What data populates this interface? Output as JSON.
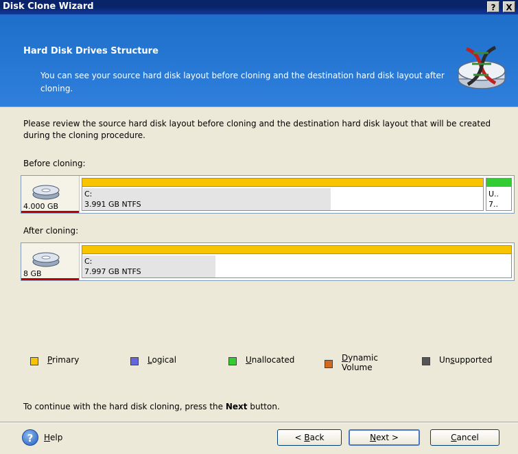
{
  "window": {
    "title": "Disk Clone Wizard",
    "help_btn": "?",
    "close_btn": "X"
  },
  "header": {
    "title": "Hard Disk Drives Structure",
    "description": "You can see your source hard disk layout before cloning and the destination hard disk layout after cloning."
  },
  "intro": "Please review the source hard disk layout before cloning and the destination hard disk layout that will be created during the cloning procedure.",
  "before": {
    "label": "Before cloning:",
    "disk_size": "4.000 GB",
    "partitions": [
      {
        "name": "C:",
        "info": "3.991 GB  NTFS",
        "type": "primary",
        "used_fraction": 0.62
      },
      {
        "name": "U..",
        "info": "7..",
        "type": "unallocated",
        "used_fraction": 0
      }
    ]
  },
  "after": {
    "label": "After cloning:",
    "disk_size": "8 GB",
    "partitions": [
      {
        "name": "C:",
        "info": "7.997 GB  NTFS",
        "type": "primary",
        "used_fraction": 0.31
      }
    ]
  },
  "legend": [
    {
      "key": "P",
      "rest": "rimary",
      "color": "#f8c400"
    },
    {
      "key": "L",
      "rest": "ogical",
      "color": "#6666dd"
    },
    {
      "key": "U",
      "rest": "nallocated",
      "color": "#33cc33"
    },
    {
      "key": "D",
      "rest": "ynamic",
      "line2": "Volume",
      "color": "#d2691e"
    },
    {
      "pre": "Un",
      "key": "s",
      "rest": "upported",
      "color": "#555555"
    }
  ],
  "continue": {
    "text": "To continue with the hard disk cloning, press the ",
    "bold": "Next",
    "after": " button."
  },
  "footer": {
    "help": {
      "key": "H",
      "rest": "elp"
    },
    "back": {
      "pre": "< ",
      "key": "B",
      "rest": "ack"
    },
    "next": {
      "key": "N",
      "rest": "ext >"
    },
    "cancel": {
      "key": "C",
      "rest": "ancel"
    }
  },
  "colors": {
    "primary": "#f8c400",
    "unallocated": "#33cc33",
    "header_bg": "#2f7fdc"
  }
}
